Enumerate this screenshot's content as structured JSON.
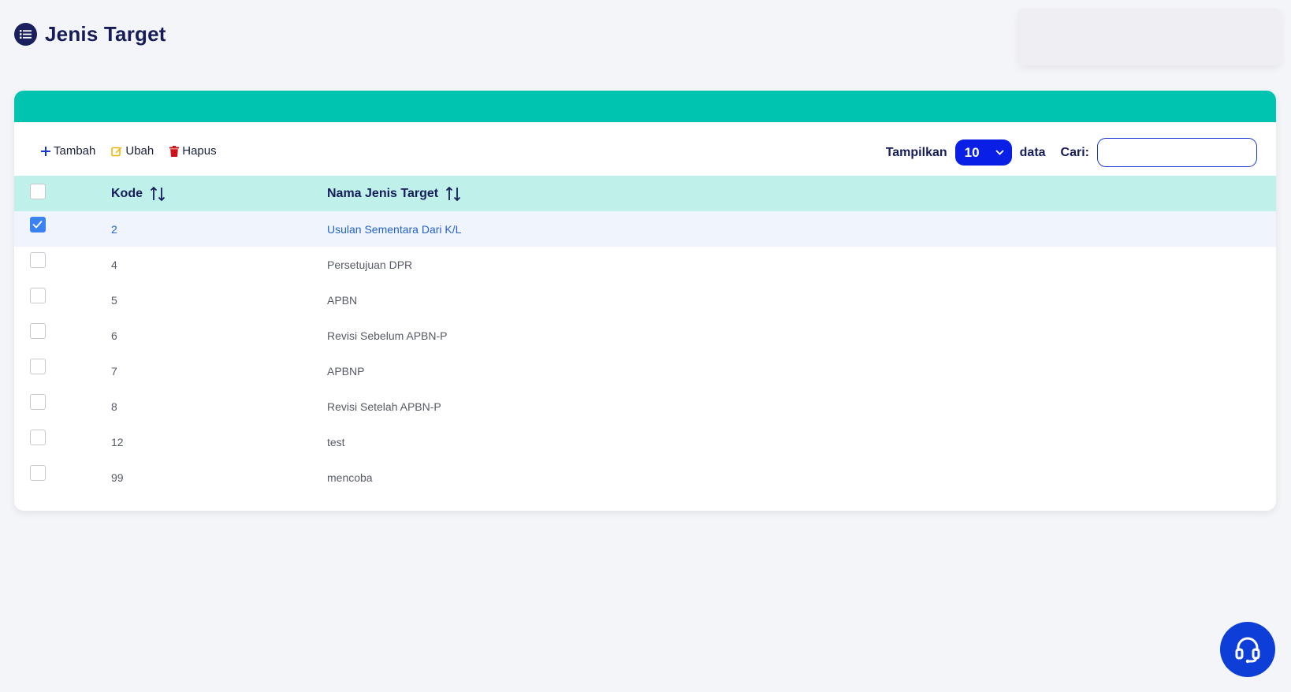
{
  "page": {
    "title": "Jenis Target",
    "title_icon": "list-icon"
  },
  "colors": {
    "accent_teal": "#00c3b0",
    "header_row": "#bff0ea",
    "primary_blue": "#0a1fe6",
    "title_navy": "#161c5a"
  },
  "toolbar": {
    "add_label": "Tambah",
    "edit_label": "Ubah",
    "delete_label": "Hapus",
    "show_label": "Tampilkan",
    "page_size": "10",
    "data_label": "data",
    "search_label": "Cari:",
    "search_value": ""
  },
  "table": {
    "headers": {
      "kode": "Kode",
      "nama": "Nama Jenis Target"
    },
    "rows": [
      {
        "kode": "2",
        "nama": "Usulan Sementara Dari K/L",
        "checked": true
      },
      {
        "kode": "4",
        "nama": "Persetujuan DPR",
        "checked": false
      },
      {
        "kode": "5",
        "nama": "APBN",
        "checked": false
      },
      {
        "kode": "6",
        "nama": "Revisi Sebelum APBN-P",
        "checked": false
      },
      {
        "kode": "7",
        "nama": "APBNP",
        "checked": false
      },
      {
        "kode": "8",
        "nama": "Revisi Setelah APBN-P",
        "checked": false
      },
      {
        "kode": "12",
        "nama": "test",
        "checked": false
      },
      {
        "kode": "99",
        "nama": "mencoba",
        "checked": false
      }
    ]
  },
  "support": {
    "icon": "headset-icon"
  }
}
